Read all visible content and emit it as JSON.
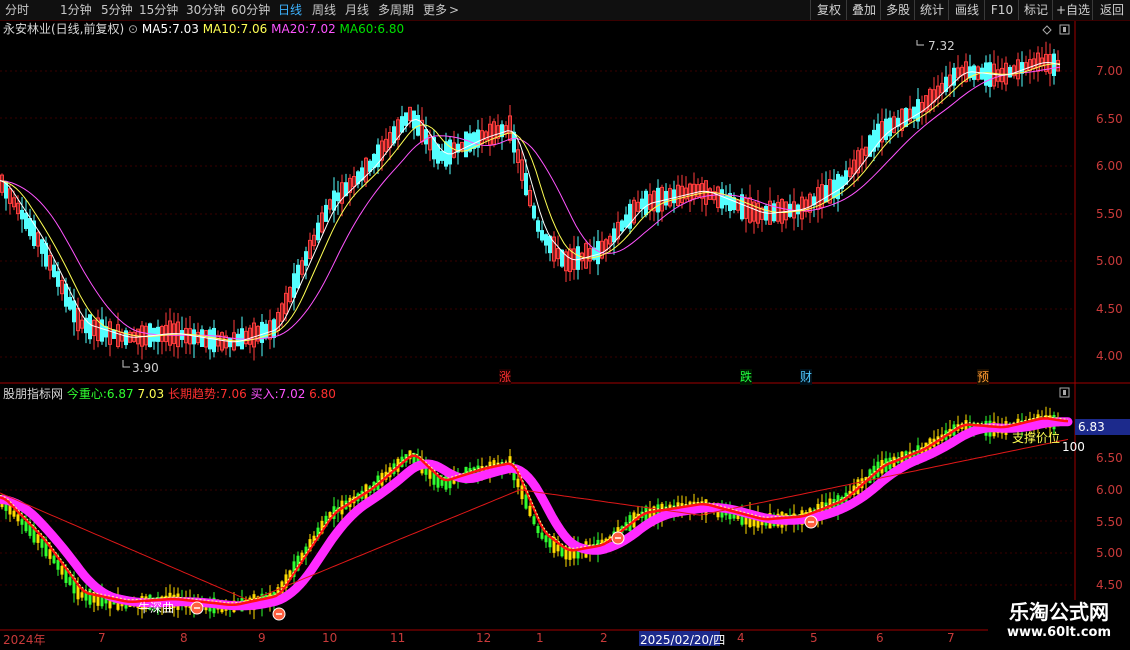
{
  "toolbar": {
    "left_items": [
      "分时",
      "1分钟",
      "5分钟",
      "15分钟",
      "30分钟",
      "60分钟",
      "日线",
      "周线",
      "月线",
      "多周期",
      "更多"
    ],
    "active": "日线",
    "more_arrow": ">",
    "right_items": [
      "复权",
      "叠加",
      "多股",
      "统计",
      "画线",
      "F10",
      "标记",
      "+自选",
      "返回"
    ]
  },
  "main_chart": {
    "stock_name": "永安林业(日线,前复权)",
    "ma5_label": "MA5:",
    "ma5_value": "7.03",
    "ma10_label": "MA10:",
    "ma10_value": "7.06",
    "ma20_label": "MA20:",
    "ma20_value": "7.02",
    "ma60_label": "MA60:",
    "ma60_value": "6.80",
    "high_marker": "7.32",
    "low_marker": "3.90",
    "y_ticks": [
      "7.00",
      "6.50",
      "6.00",
      "5.50",
      "5.00",
      "4.50",
      "4.00"
    ],
    "event_markers": [
      "涨",
      "跌",
      "财",
      "预"
    ]
  },
  "indicator_panel": {
    "name": "股朋指标网",
    "center_label": "今重心:",
    "center_value": "6.87",
    "center_value2": "7.03",
    "trend_label": "长期趋势:",
    "trend_value": "7.06",
    "buy_label": "买入:",
    "buy_value": "7.02",
    "buy_value2": "6.80",
    "price_tag": "6.83",
    "support_label": "支撑价位",
    "label_100": "100",
    "niu_label": "牛深曲",
    "y_ticks": [
      "6.50",
      "6.00",
      "5.50",
      "5.00",
      "4.50"
    ]
  },
  "x_axis": {
    "labels": [
      "2024年",
      "7",
      "8",
      "9",
      "10",
      "11",
      "12",
      "1",
      "2",
      "2025/02/20/四",
      "4",
      "5",
      "6",
      "7"
    ]
  },
  "watermark": {
    "title": "乐淘公式网",
    "url": "www.60lt.com"
  },
  "colors": {
    "up": "#ff3c3c",
    "down": "#54ffff",
    "ma5": "#ffffff",
    "ma10": "#ffff54",
    "ma20": "#ff54ff",
    "ma60": "#00e000",
    "band": "#ff2aff",
    "trend": "#ff2020"
  }
}
